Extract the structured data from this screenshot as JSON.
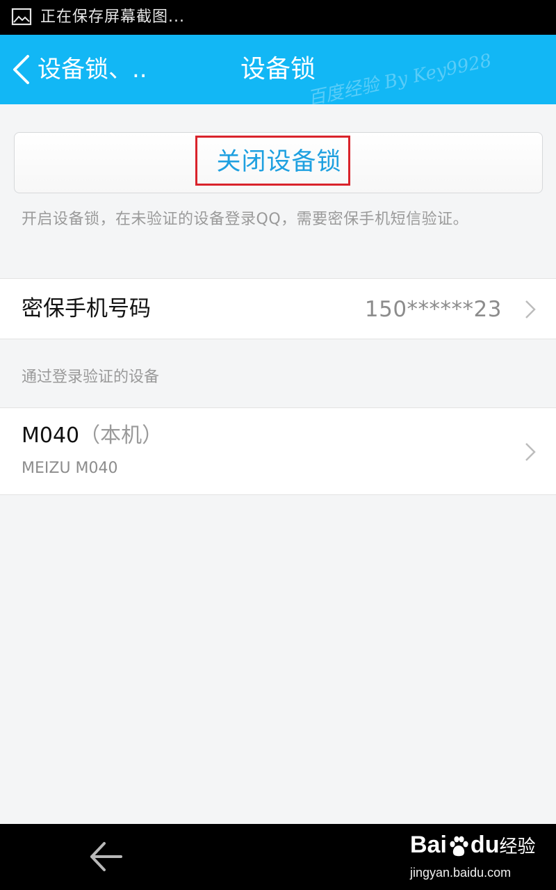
{
  "status_bar": {
    "text": "正在保存屏幕截图..."
  },
  "header": {
    "back_label": "设备锁、..",
    "title": "设备锁",
    "watermark": "百度经验 By Key9928"
  },
  "lock_button": {
    "label": "关闭设备锁"
  },
  "hint": "开启设备锁，在未验证的设备登录QQ，需要密保手机短信验证。",
  "phone_row": {
    "label": "密保手机号码",
    "value": "150******23"
  },
  "devices_section": {
    "title": "通过登录验证的设备"
  },
  "device": {
    "name": "M040",
    "suffix": "（本机）",
    "model": "MEIZU M040"
  },
  "baidu": {
    "brand_left": "Bai",
    "brand_right": "du",
    "brand_cn": "经验",
    "site": "jingyan.baidu.com"
  },
  "colors": {
    "header_blue": "#12b7f5",
    "link_blue": "#1ea0e0",
    "highlight_red": "#d9232b"
  },
  "icons": [
    "screenshot-icon",
    "back-chevron-icon",
    "chevron-right-icon",
    "nav-back-arrow-icon",
    "baidu-paw-icon"
  ]
}
